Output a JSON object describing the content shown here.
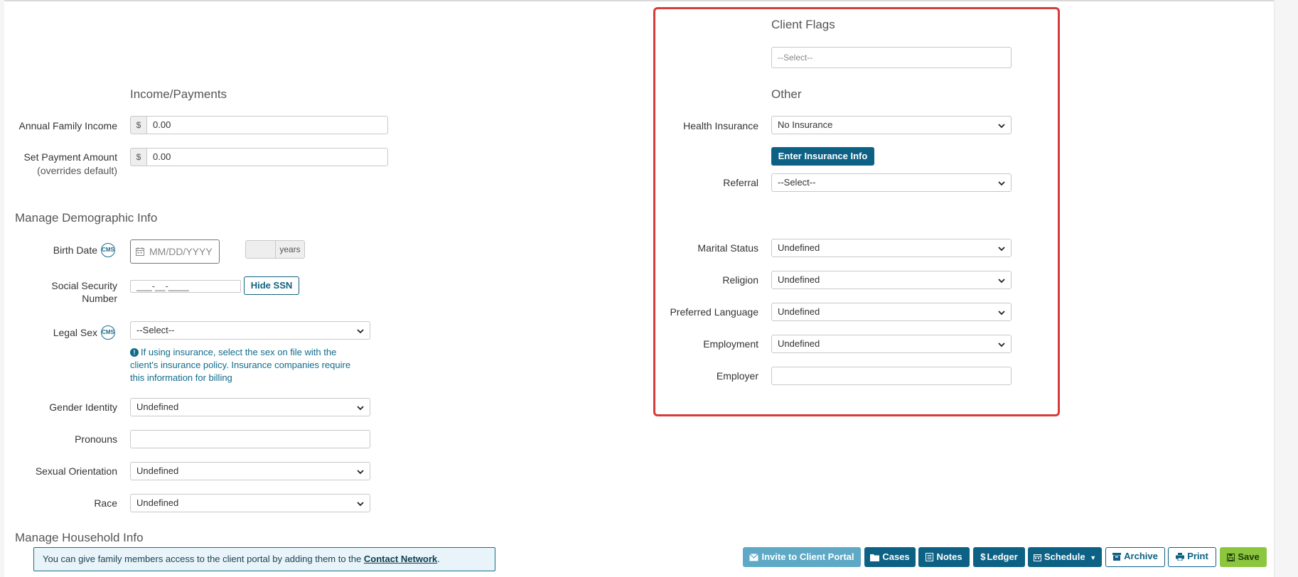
{
  "income": {
    "heading": "Income/Payments",
    "annual_family_income": {
      "label": "Annual Family Income",
      "currency": "$",
      "value": "0.00"
    },
    "set_payment_amount": {
      "label": "Set Payment Amount",
      "sublabel": "(overrides default)",
      "currency": "$",
      "value": "0.00"
    }
  },
  "demographic": {
    "heading": "Manage Demographic Info",
    "birth_date": {
      "label": "Birth Date",
      "placeholder": "MM/DD/YYYY",
      "cms_badge": "CMS",
      "age_value": "",
      "age_unit": "years"
    },
    "ssn": {
      "label_line1": "Social Security",
      "label_line2": "Number",
      "value": "___-__-____",
      "hide_button": "Hide SSN"
    },
    "legal_sex": {
      "label": "Legal Sex",
      "cms_badge": "CMS",
      "value": "--Select--"
    },
    "legal_sex_note": {
      "line1": "If using insurance, select the sex on file with the",
      "line2": "client's insurance policy. Insurance companies require",
      "line3": "this information for billing"
    },
    "gender_identity": {
      "label": "Gender Identity",
      "value": "Undefined"
    },
    "pronouns": {
      "label": "Pronouns",
      "value": ""
    },
    "sexual_orientation": {
      "label": "Sexual Orientation",
      "value": "Undefined"
    },
    "race": {
      "label": "Race",
      "value": "Undefined"
    }
  },
  "household": {
    "heading": "Manage Household Info",
    "alert_prefix": "You can give family members access to the client portal by adding them to the ",
    "alert_link": "Contact Network",
    "alert_suffix": "."
  },
  "client_flags": {
    "heading": "Client Flags",
    "placeholder": "--Select--"
  },
  "other": {
    "heading": "Other",
    "health_insurance": {
      "label": "Health Insurance",
      "value": "No Insurance"
    },
    "enter_insurance_button": "Enter Insurance Info",
    "referral": {
      "label": "Referral",
      "value": "--Select--"
    },
    "marital_status": {
      "label": "Marital Status",
      "value": "Undefined"
    },
    "religion": {
      "label": "Religion",
      "value": "Undefined"
    },
    "preferred_language": {
      "label": "Preferred Language",
      "value": "Undefined"
    },
    "employment": {
      "label": "Employment",
      "value": "Undefined"
    },
    "employer": {
      "label": "Employer",
      "value": ""
    }
  },
  "toolbar": {
    "invite": "Invite to Client Portal",
    "cases": "Cases",
    "notes": "Notes",
    "ledger": "Ledger",
    "schedule": "Schedule",
    "archive": "Archive",
    "print": "Print",
    "save": "Save"
  },
  "colors": {
    "primary": "#0d6184",
    "highlight_border": "#d63b3b",
    "save_green": "#8cc63f",
    "info_text": "#0f6b8c"
  }
}
